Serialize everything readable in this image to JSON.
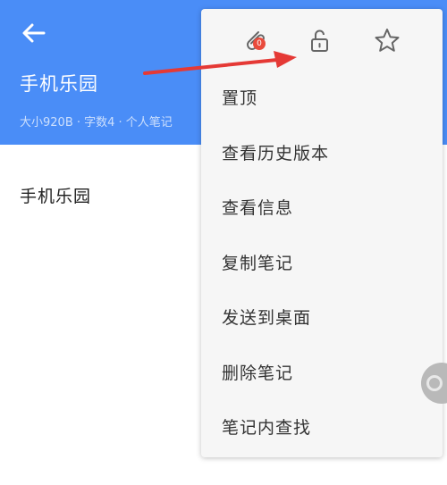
{
  "header": {
    "title": "手机乐园",
    "meta": "大小920B · 字数4 · 个人笔记",
    "back_icon": "arrow-left-icon",
    "color": "#4a8df7"
  },
  "content": {
    "text": "手机乐园"
  },
  "menu": {
    "icons": [
      {
        "name": "paperclip-icon",
        "badge": "0"
      },
      {
        "name": "unlock-icon"
      },
      {
        "name": "star-icon"
      }
    ],
    "items": [
      {
        "label": "置顶"
      },
      {
        "label": "查看历史版本"
      },
      {
        "label": "查看信息"
      },
      {
        "label": "复制笔记"
      },
      {
        "label": "发送到桌面"
      },
      {
        "label": "删除笔记"
      },
      {
        "label": "笔记内查找"
      }
    ]
  },
  "colors": {
    "accent": "#4a8df7",
    "badge": "#e94b3c",
    "annotation_arrow": "#e53935"
  }
}
